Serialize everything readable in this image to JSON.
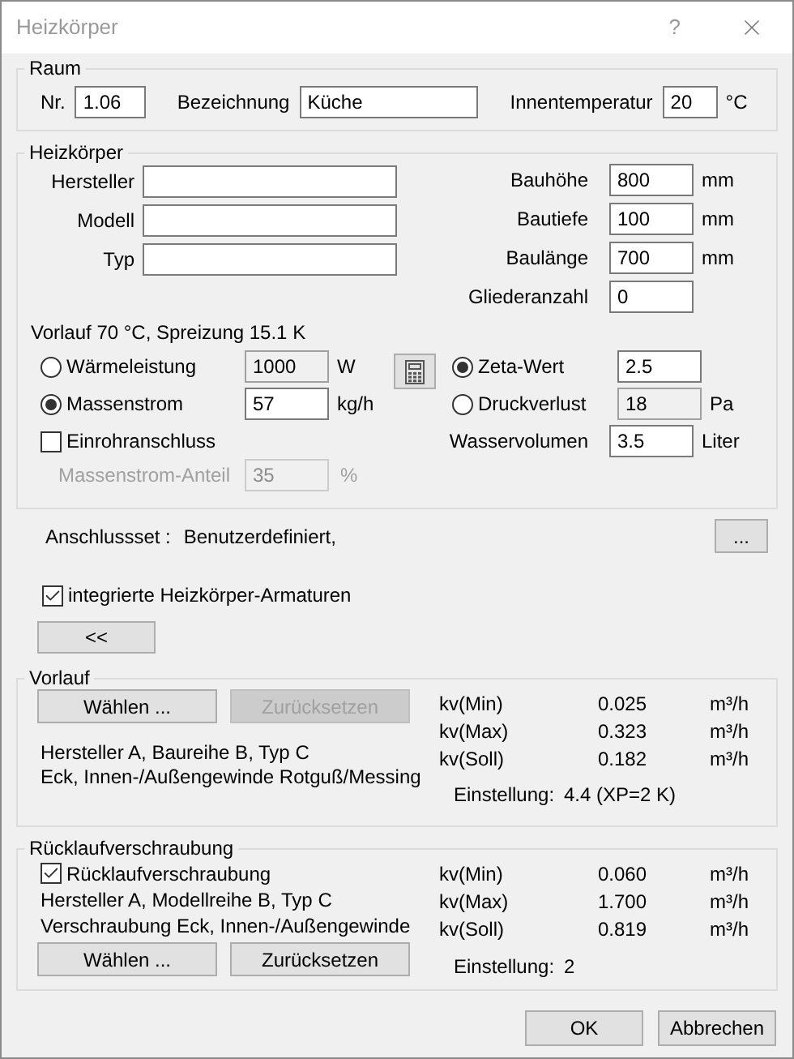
{
  "window": {
    "title": "Heizkörper",
    "help": "?"
  },
  "raum": {
    "title": "Raum",
    "fields": [
      {
        "label": "Nr.",
        "value": "1.06",
        "kind": "short"
      },
      {
        "label": "Bezeichnung",
        "value": "Küche",
        "kind": "long"
      },
      {
        "label": "Innentemperatur",
        "value": "20",
        "kind": "tiny",
        "unit": "°C"
      }
    ]
  },
  "heizkoerper": {
    "title": "Heizkörper",
    "left_fields": [
      {
        "label": "Hersteller"
      },
      {
        "label": "Modell"
      },
      {
        "label": "Typ"
      }
    ],
    "right_fields": [
      {
        "label": "Bauhöhe",
        "value": "800",
        "unit": "mm"
      },
      {
        "label": "Bautiefe",
        "value": "100",
        "unit": "mm"
      },
      {
        "label": "Baulänge",
        "value": "700",
        "unit": "mm"
      },
      {
        "label": "Gliederanzahl",
        "value": "0"
      }
    ],
    "info": "Vorlauf 70 °C, Spreizung 15.1 K",
    "left_radios": [
      {
        "label": "Wärmeleistung",
        "value": "1000",
        "unit": "W",
        "selected": false
      },
      {
        "label": "Massenstrom",
        "value": "57",
        "unit": "kg/h",
        "selected": true
      }
    ],
    "right_radios": [
      {
        "label": "Zeta-Wert",
        "value": "2.5",
        "selected": true
      },
      {
        "label": "Druckverlust",
        "value": "18",
        "unit": "Pa",
        "selected": false
      }
    ],
    "einrohr": {
      "label": "Einrohranschluss",
      "checked": false
    },
    "anteil": {
      "label": "Massenstrom-Anteil",
      "value": "35",
      "unit": "%",
      "disabled": true
    },
    "wasservolumen": {
      "label": "Wasservolumen",
      "value": "3.5",
      "unit": "Liter"
    }
  },
  "anschlussset": {
    "label": "Anschlussset :",
    "value": "Benutzerdefiniert,",
    "button": "..."
  },
  "armaturen": {
    "label": "integrierte Heizkörper-Armaturen",
    "checked": true
  },
  "collapse_button": "<<",
  "vorlauf": {
    "title": "Vorlauf",
    "buttons": [
      {
        "label": "Wählen ...",
        "disabled": false
      },
      {
        "label": "Zurücksetzen",
        "disabled": true
      }
    ],
    "lines": [
      "Hersteller A, Baureihe B, Typ C",
      "Eck, Innen-/Außengewinde Rotguß/Messing"
    ],
    "kv": [
      {
        "label": "kv(Min)",
        "value": "0.025",
        "unit": "m³/h"
      },
      {
        "label": "kv(Max)",
        "value": "0.323",
        "unit": "m³/h"
      },
      {
        "label": "kv(Soll)",
        "value": "0.182",
        "unit": "m³/h"
      }
    ],
    "einstellung": {
      "label": "Einstellung:",
      "value": "4.4 (XP=2 K)"
    }
  },
  "ruecklauf": {
    "title": "Rücklaufverschraubung",
    "checkbox": {
      "label": "Rücklaufverschraubung",
      "checked": true
    },
    "lines": [
      "Hersteller A, Modellreihe B, Typ C",
      "Verschraubung Eck, Innen-/Außengewinde"
    ],
    "buttons": [
      {
        "label": "Wählen ...",
        "disabled": false
      },
      {
        "label": "Zurücksetzen",
        "disabled": false
      }
    ],
    "kv": [
      {
        "label": "kv(Min)",
        "value": "0.060",
        "unit": "m³/h"
      },
      {
        "label": "kv(Max)",
        "value": "1.700",
        "unit": "m³/h"
      },
      {
        "label": "kv(Soll)",
        "value": "0.819",
        "unit": "m³/h"
      }
    ],
    "einstellung": {
      "label": "Einstellung:",
      "value": "2"
    }
  },
  "footer": [
    "OK",
    "Abbrechen"
  ]
}
